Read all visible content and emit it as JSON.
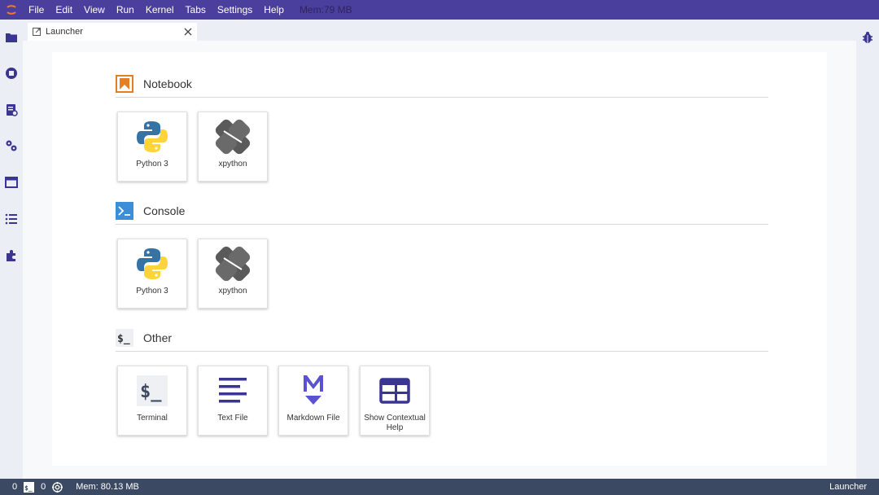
{
  "menubar": {
    "items": [
      "File",
      "Edit",
      "View",
      "Run",
      "Kernel",
      "Tabs",
      "Settings",
      "Help"
    ],
    "memory": "Mem:79 MB",
    "logo_icon": "jupyter-logo-icon"
  },
  "left_sidebar": {
    "icons": [
      "folder-icon",
      "running-icon",
      "commands-icon",
      "property-inspector-icon",
      "tabs-icon",
      "toc-icon",
      "extension-icon"
    ]
  },
  "right_sidebar": {
    "icons": [
      "debugger-icon"
    ]
  },
  "tabs": [
    {
      "label": "Launcher",
      "icon": "launcher-icon",
      "close_icon": "close-icon"
    }
  ],
  "sections": {
    "notebook": {
      "title": "Notebook",
      "icon": "notebook-icon",
      "cards": [
        {
          "label": "Python 3",
          "icon": "python-logo-icon"
        },
        {
          "label": "xpython",
          "icon": "xpython-logo-icon"
        }
      ]
    },
    "console": {
      "title": "Console",
      "icon": "console-icon",
      "cards": [
        {
          "label": "Python 3",
          "icon": "python-logo-icon"
        },
        {
          "label": "xpython",
          "icon": "xpython-logo-icon"
        }
      ]
    },
    "other": {
      "title": "Other",
      "icon": "other-icon",
      "cards": [
        {
          "label": "Terminal",
          "icon": "terminal-icon"
        },
        {
          "label": "Text File",
          "icon": "text-file-icon"
        },
        {
          "label": "Markdown File",
          "icon": "markdown-icon"
        },
        {
          "label": "Show Contextual Help",
          "icon": "contextual-help-icon"
        }
      ]
    }
  },
  "statusbar": {
    "terminals_count": "0",
    "kernels_count": "0",
    "terminal_icon": "terminal-small-icon",
    "kernel_icon": "kernel-icon",
    "memory": "Mem: 80.13 MB",
    "current_view": "Launcher"
  },
  "colors": {
    "menubar": "#4a3f9c",
    "sidebar_icons": "#3a3590",
    "statusbar": "#3b4963",
    "notebook_orange": "#e67e22",
    "console_blue": "#3b8fd9",
    "python_blue": "#3772a4",
    "python_yellow": "#ffd43b"
  }
}
